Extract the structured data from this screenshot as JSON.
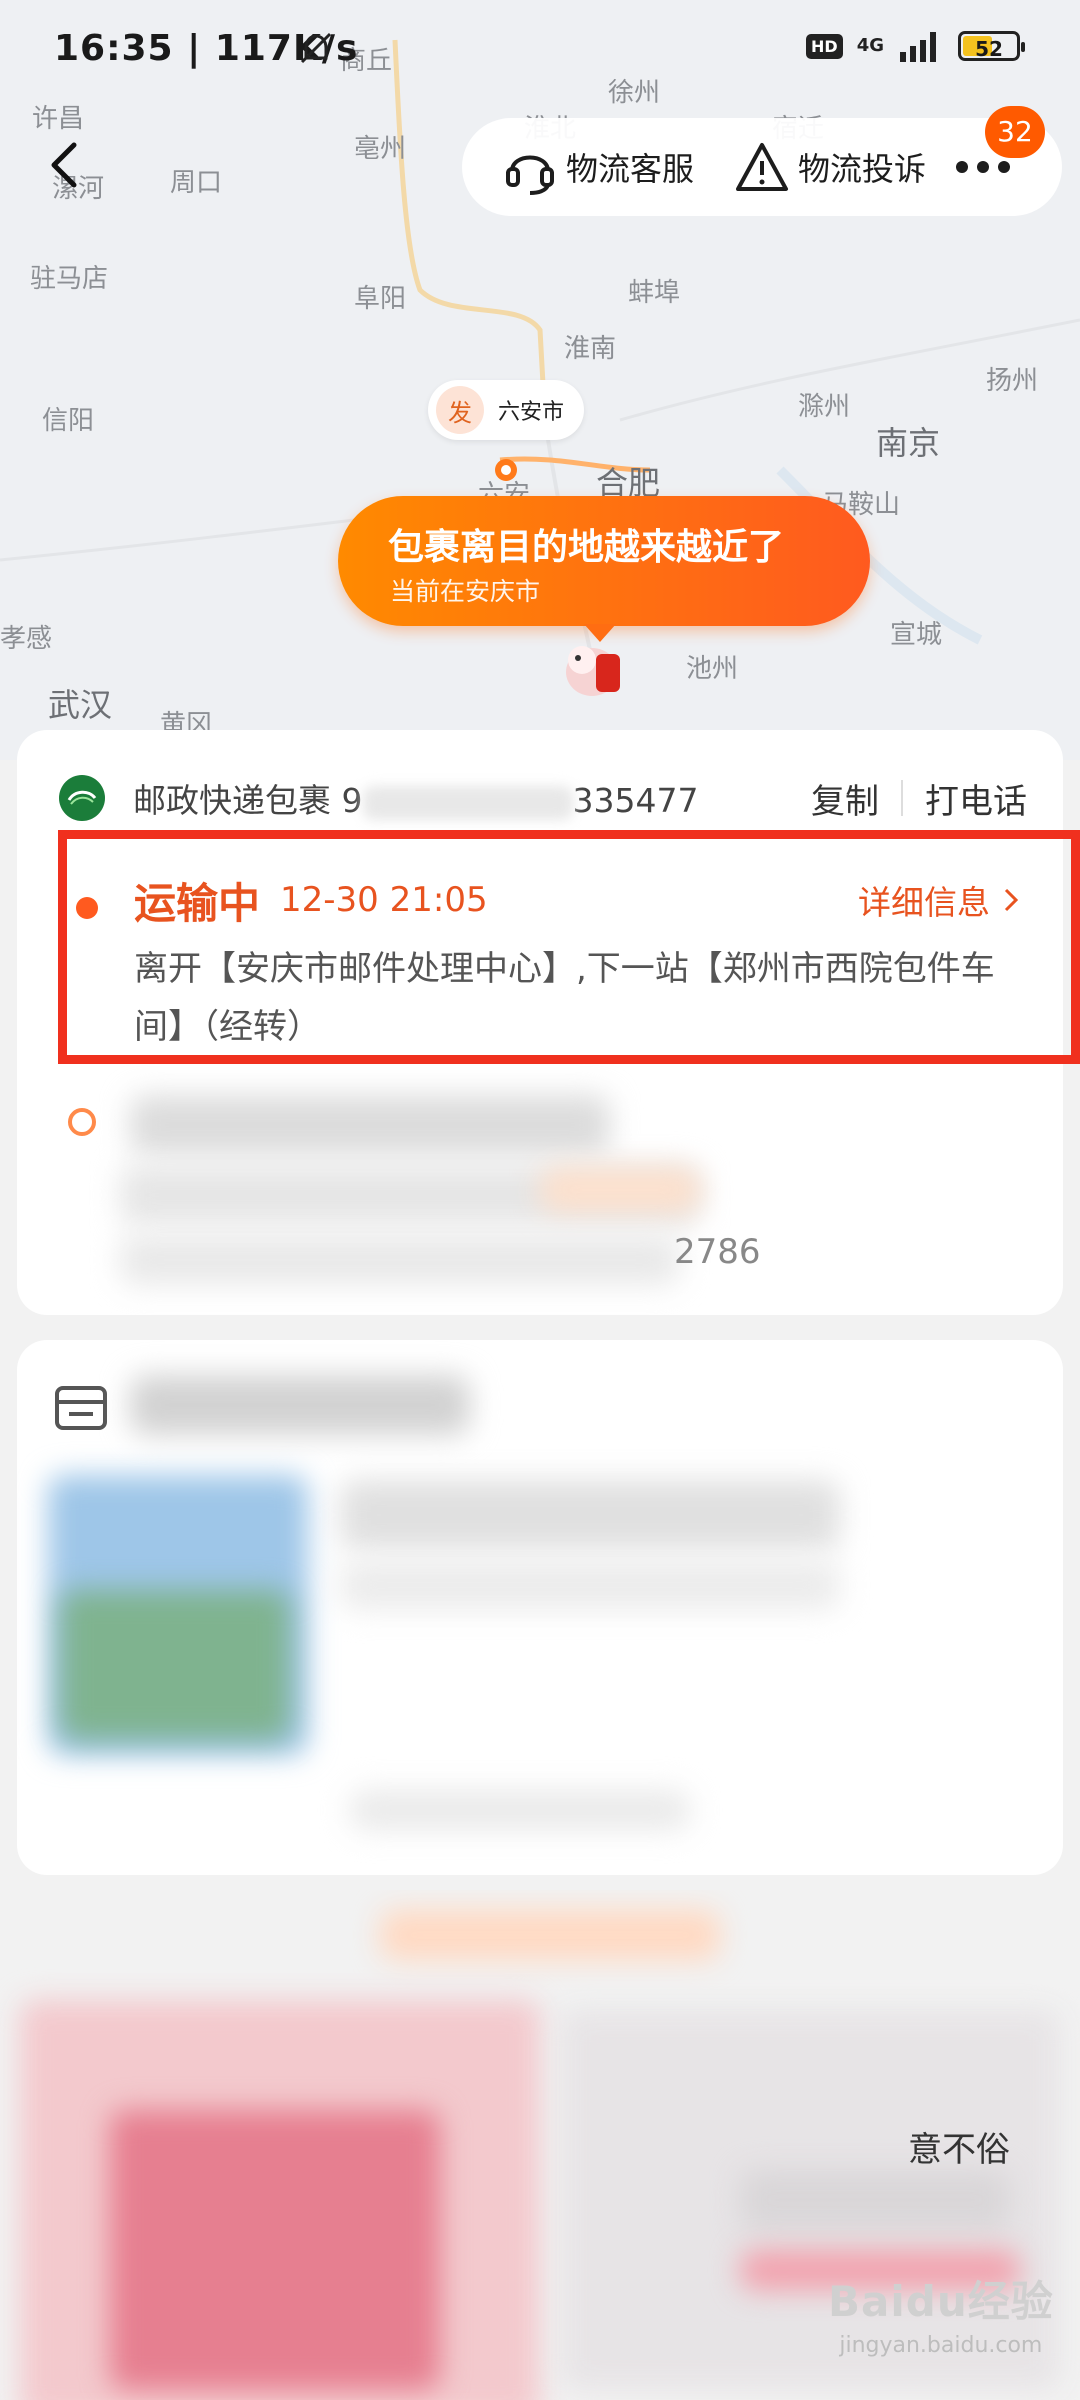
{
  "status_bar": {
    "time": "16:35",
    "net_speed": "117K/s",
    "hd": "HD",
    "network": "4G",
    "battery": "52"
  },
  "map": {
    "cities": [
      "商丘",
      "徐州",
      "许昌",
      "亳州",
      "淮北",
      "宿迁",
      "漯河",
      "周口",
      "驻马店",
      "阜阳",
      "蚌埠",
      "淮南",
      "扬州",
      "信阳",
      "滁州",
      "南京",
      "合肥",
      "马鞍山",
      "孝感",
      "宣城",
      "池州",
      "武汉",
      "黄冈",
      "六安"
    ],
    "origin_marker": "发",
    "origin_city": "六安市",
    "bubble_title": "包裹离目的地越来越近了",
    "bubble_subtitle": "当前在安庆市"
  },
  "header": {
    "service_label": "物流客服",
    "complaint_label": "物流投诉",
    "badge_count": "32"
  },
  "tracking": {
    "carrier_prefix": "邮政快递包裹 9",
    "carrier_suffix": "335477",
    "copy_label": "复制",
    "call_label": "打电话",
    "status": "运输中",
    "status_time": "12-30 21:05",
    "detail_label": "详细信息",
    "description": "离开【安庆市邮件处理中心】,下一站【郑州市西院包件车间】（经转）",
    "blurred_tail": "2786"
  },
  "bottom": {
    "partial_text": "意不俗"
  },
  "watermark": {
    "logo": "Baidu经验",
    "url": "jingyan.baidu.com"
  },
  "colors": {
    "accent": "#e8531f",
    "highlight": "#f0301e",
    "badge": "#ff5a00"
  }
}
